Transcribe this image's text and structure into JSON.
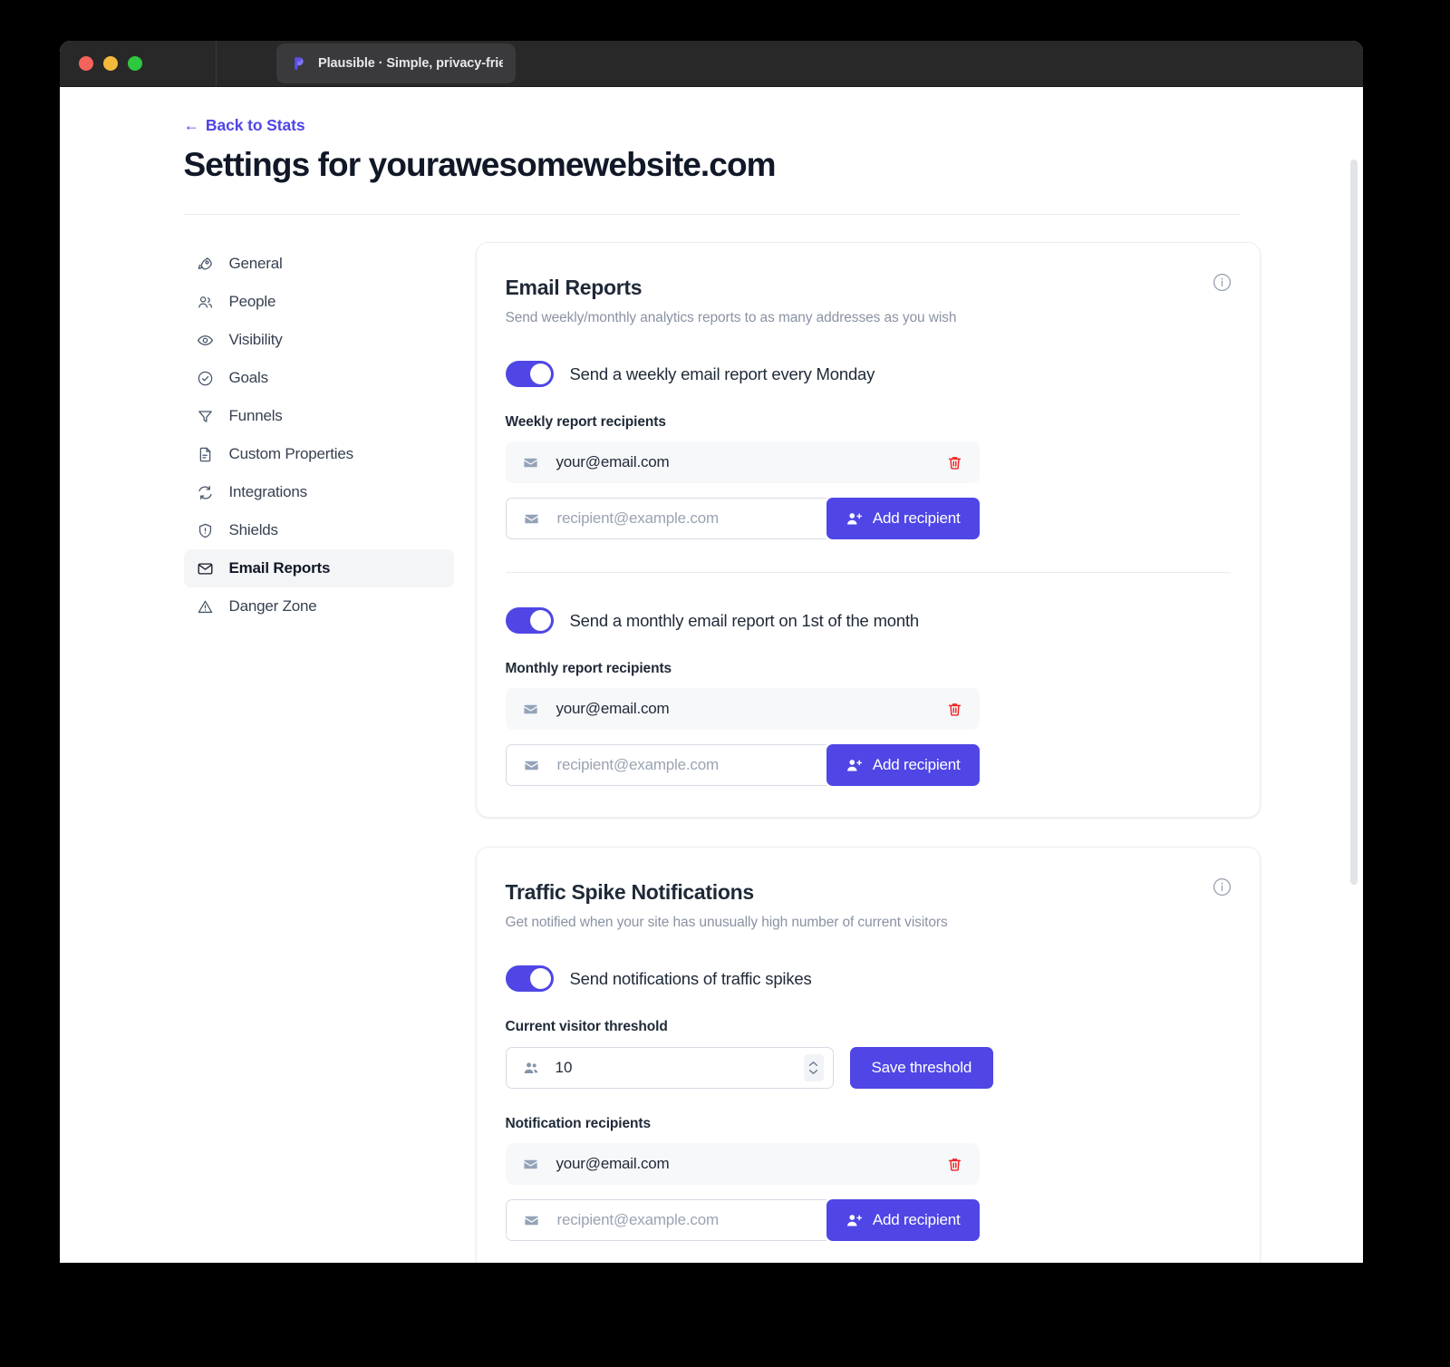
{
  "browser": {
    "tab_title": "Plausible · Simple, privacy-frien",
    "favicon": "plausible-logo-icon",
    "traffic_lights": [
      "close-button",
      "minimize-button",
      "maximize-button"
    ]
  },
  "header": {
    "back_link": "Back to Stats",
    "back_arrow": "←",
    "page_title": "Settings for yourawesomewebsite.com"
  },
  "sidebar": {
    "items": [
      {
        "label": "General",
        "icon": "rocket-icon",
        "active": false
      },
      {
        "label": "People",
        "icon": "people-icon",
        "active": false
      },
      {
        "label": "Visibility",
        "icon": "eye-icon",
        "active": false
      },
      {
        "label": "Goals",
        "icon": "check-circle-icon",
        "active": false
      },
      {
        "label": "Funnels",
        "icon": "funnel-icon",
        "active": false
      },
      {
        "label": "Custom Properties",
        "icon": "document-icon",
        "active": false
      },
      {
        "label": "Integrations",
        "icon": "refresh-icon",
        "active": false
      },
      {
        "label": "Shields",
        "icon": "shield-icon",
        "active": false
      },
      {
        "label": "Email Reports",
        "icon": "mail-icon",
        "active": true
      },
      {
        "label": "Danger Zone",
        "icon": "warning-triangle-icon",
        "active": false
      }
    ]
  },
  "email_reports_card": {
    "title": "Email Reports",
    "subtitle": "Send weekly/monthly analytics reports to as many addresses as you wish",
    "info_icon": "info-circle-icon",
    "weekly": {
      "toggle_label": "Send a weekly email report every Monday",
      "toggle_on": true,
      "recipients_label": "Weekly report recipients",
      "recipients": [
        "your@email.com"
      ],
      "input_placeholder": "recipient@example.com",
      "input_value": "",
      "add_button_label": "Add recipient",
      "delete_icon": "trash-icon"
    },
    "monthly": {
      "toggle_label": "Send a monthly email report on 1st of the month",
      "toggle_on": true,
      "recipients_label": "Monthly report recipients",
      "recipients": [
        "your@email.com"
      ],
      "input_placeholder": "recipient@example.com",
      "input_value": "",
      "add_button_label": "Add recipient",
      "delete_icon": "trash-icon"
    }
  },
  "traffic_spike_card": {
    "title": "Traffic Spike Notifications",
    "subtitle": "Get notified when your site has unusually high number of current visitors",
    "info_icon": "info-circle-icon",
    "toggle_label": "Send notifications of traffic spikes",
    "toggle_on": true,
    "threshold_label": "Current visitor threshold",
    "threshold_value": "10",
    "threshold_button_label": "Save threshold",
    "recipients_label": "Notification recipients",
    "recipients": [
      "your@email.com"
    ],
    "input_placeholder": "recipient@example.com",
    "input_value": "",
    "add_button_label": "Add recipient",
    "delete_icon": "trash-icon"
  },
  "colors": {
    "accent": "#4f46e5",
    "danger": "#ef2222",
    "title_bar": "#282828",
    "page_bg": "#ffffff",
    "muted_text": "#8a93a3"
  }
}
